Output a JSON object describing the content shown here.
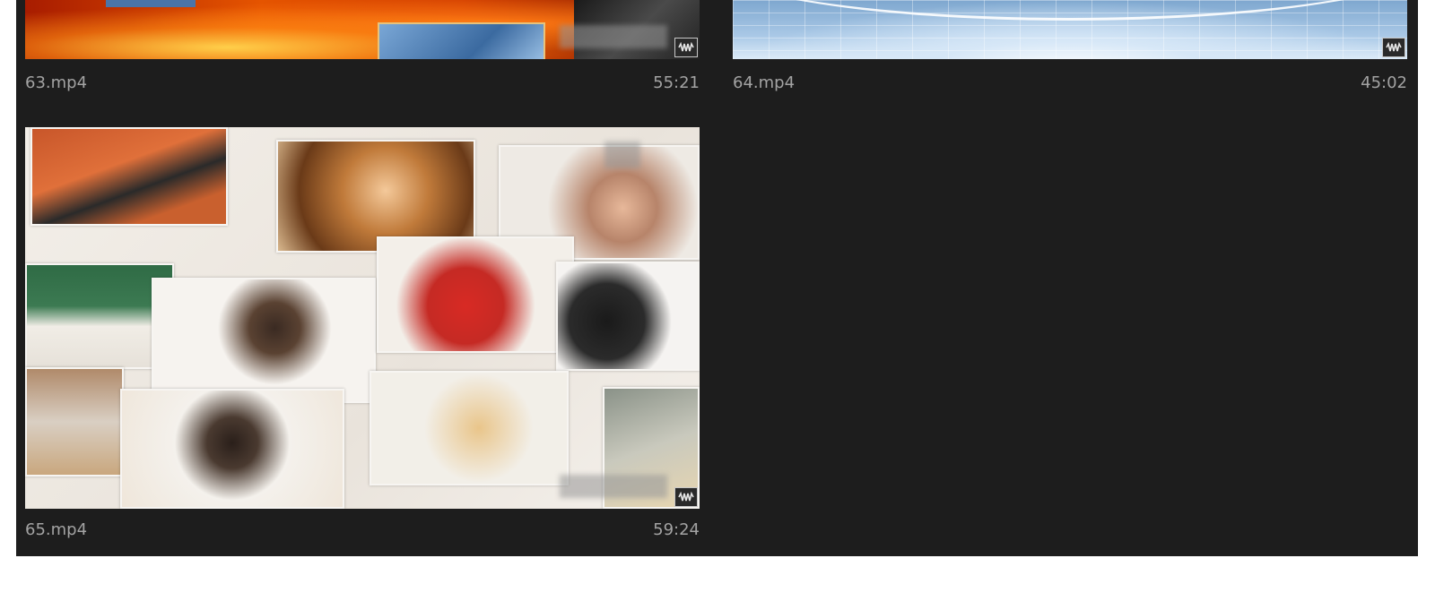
{
  "clips": [
    {
      "name": "63.mp4",
      "duration": "55:21",
      "badge_icon": "audio-waveform-icon"
    },
    {
      "name": "64.mp4",
      "duration": "45:02",
      "badge_icon": "audio-waveform-icon"
    },
    {
      "name": "65.mp4",
      "duration": "59:24",
      "badge_icon": "audio-waveform-icon"
    }
  ],
  "colors": {
    "panel_background": "#1d1d1d",
    "text": "#a3a3a3"
  }
}
